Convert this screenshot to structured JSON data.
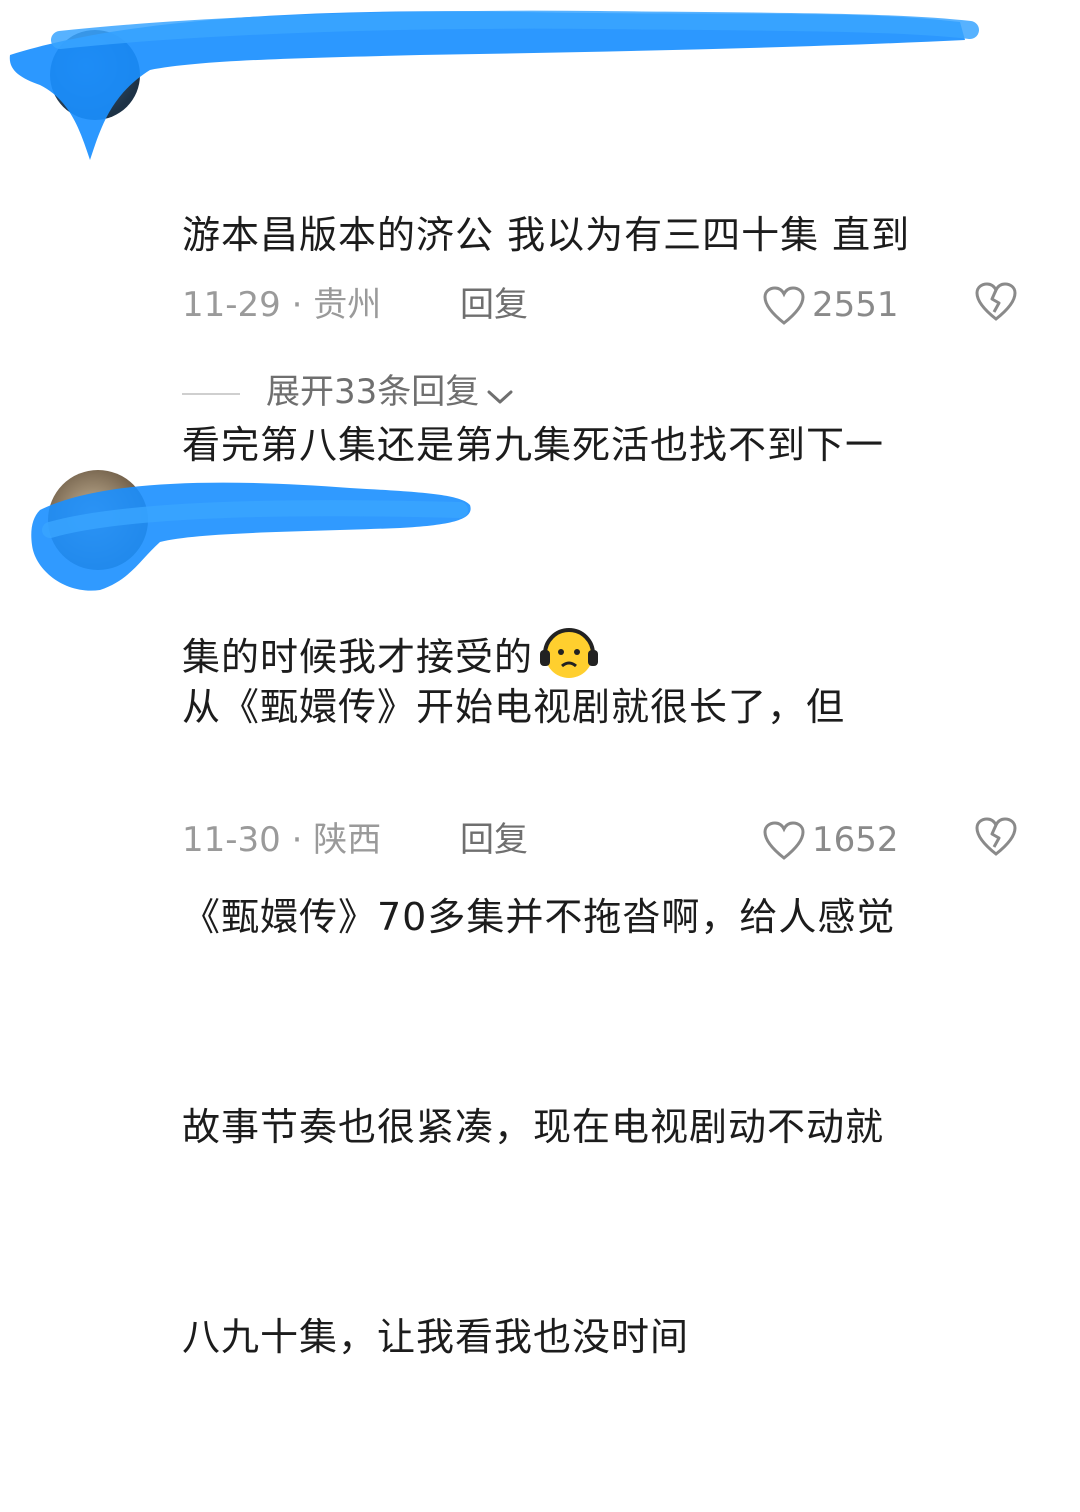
{
  "comments": [
    {
      "text_lines": [
        "游本昌版本的济公 我以为有三四十集 直到",
        "看完第八集还是第九集死活也找不到下一",
        "集的时候我才接受的"
      ],
      "emoji_icon": "headphone-face-emoji",
      "date": "11-29",
      "location": "贵州",
      "reply_label": "回复",
      "like_count": "2551",
      "expand_label": "展开33条回复"
    },
    {
      "text_lines": [
        "从《甄嬛传》开始电视剧就很长了，但",
        "《甄嬛传》70多集并不拖沓啊，给人感觉",
        "故事节奏也很紧凑，现在电视剧动不动就",
        "八九十集，让我看我也没时间"
      ],
      "date": "11-30",
      "location": "陕西",
      "reply_label": "回复",
      "like_count": "1652"
    }
  ],
  "separator": "·",
  "icons": {
    "like": "heart-outline-icon",
    "dislike": "broken-heart-icon",
    "expand": "chevron-down-icon"
  },
  "colors": {
    "scribble": "#1a8fff",
    "meta_text": "#9a9a9a"
  }
}
